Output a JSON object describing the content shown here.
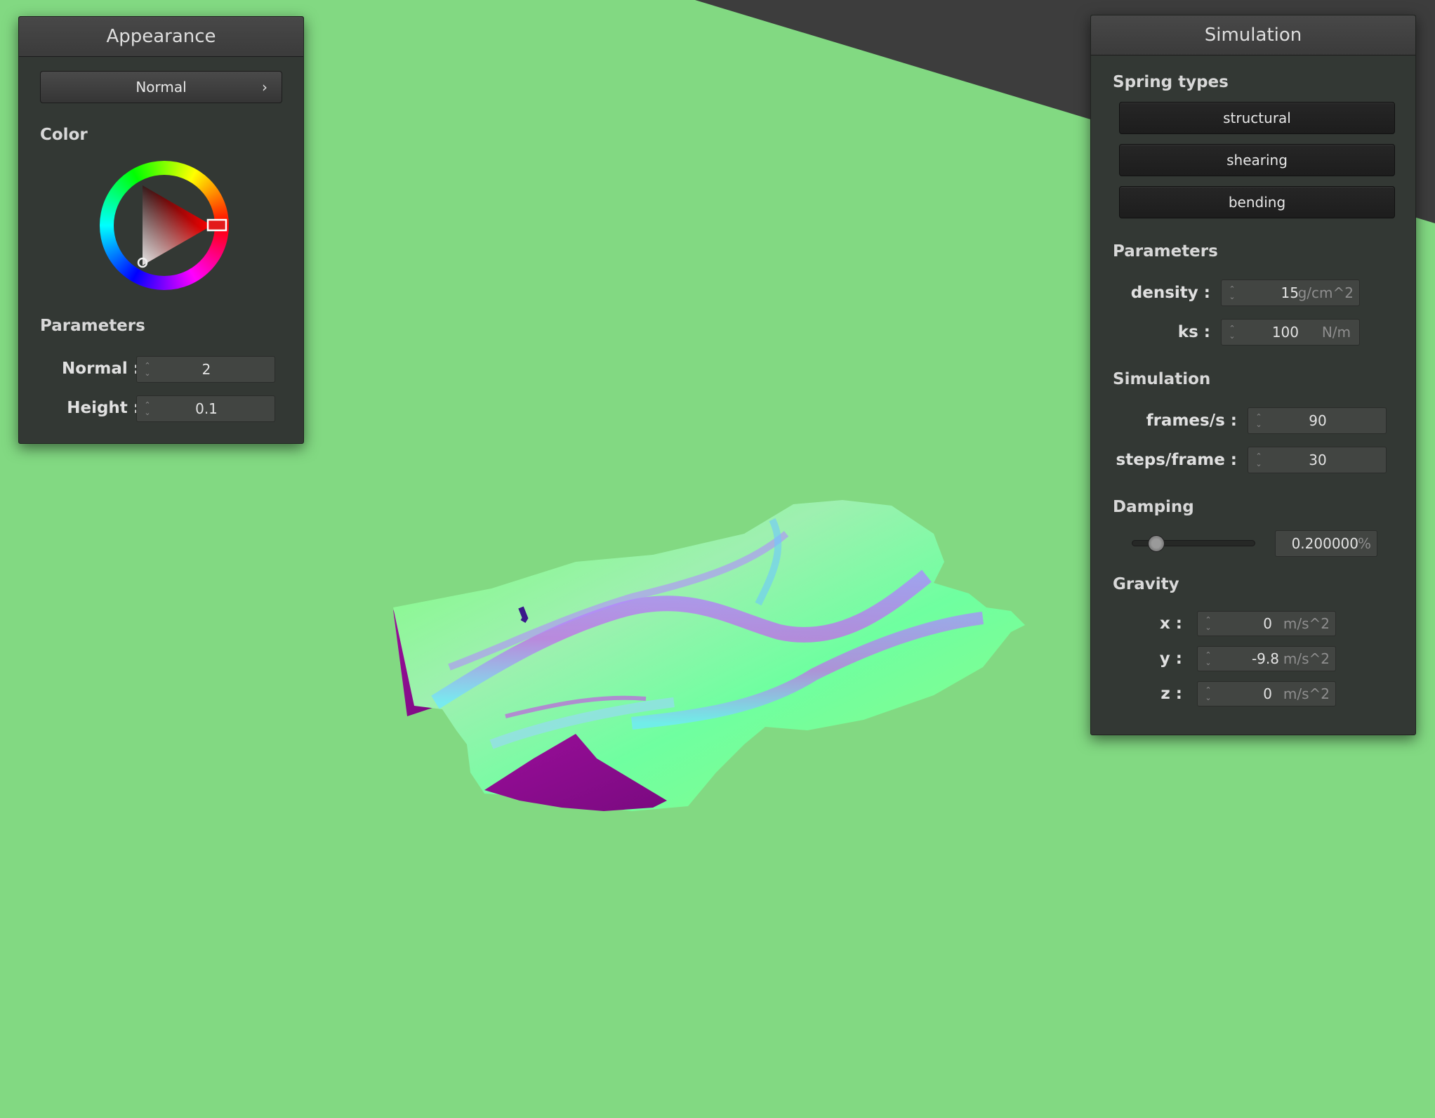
{
  "scene": {
    "background_color": "#82d982",
    "shading_mode": "normal-map"
  },
  "appearance": {
    "title": "Appearance",
    "shader_select": "Normal",
    "color_section": "Color",
    "selected_color": "#ff0000",
    "parameters_section": "Parameters",
    "normal_label": "Normal :",
    "normal_value": "2",
    "height_label": "Height :",
    "height_value": "0.1"
  },
  "simulation": {
    "title": "Simulation",
    "spring_types_section": "Spring types",
    "structural": "structural",
    "shearing": "shearing",
    "bending": "bending",
    "parameters_section": "Parameters",
    "density_label": "density :",
    "density_value": "15",
    "density_unit": "g/cm^2",
    "ks_label": "ks :",
    "ks_value": "100",
    "ks_unit": "N/m",
    "sim_section": "Simulation",
    "fps_label": "frames/s :",
    "fps_value": "90",
    "steps_label": "steps/frame :",
    "steps_value": "30",
    "damping_section": "Damping",
    "damping_value": "0.200000",
    "damping_unit": "%",
    "damping_fraction": 0.2,
    "gravity_section": "Gravity",
    "gx_label": "x :",
    "gx_value": "0",
    "gy_label": "y :",
    "gy_value": "-9.8",
    "gz_label": "z :",
    "gz_value": "0",
    "gravity_unit": "m/s^2"
  }
}
